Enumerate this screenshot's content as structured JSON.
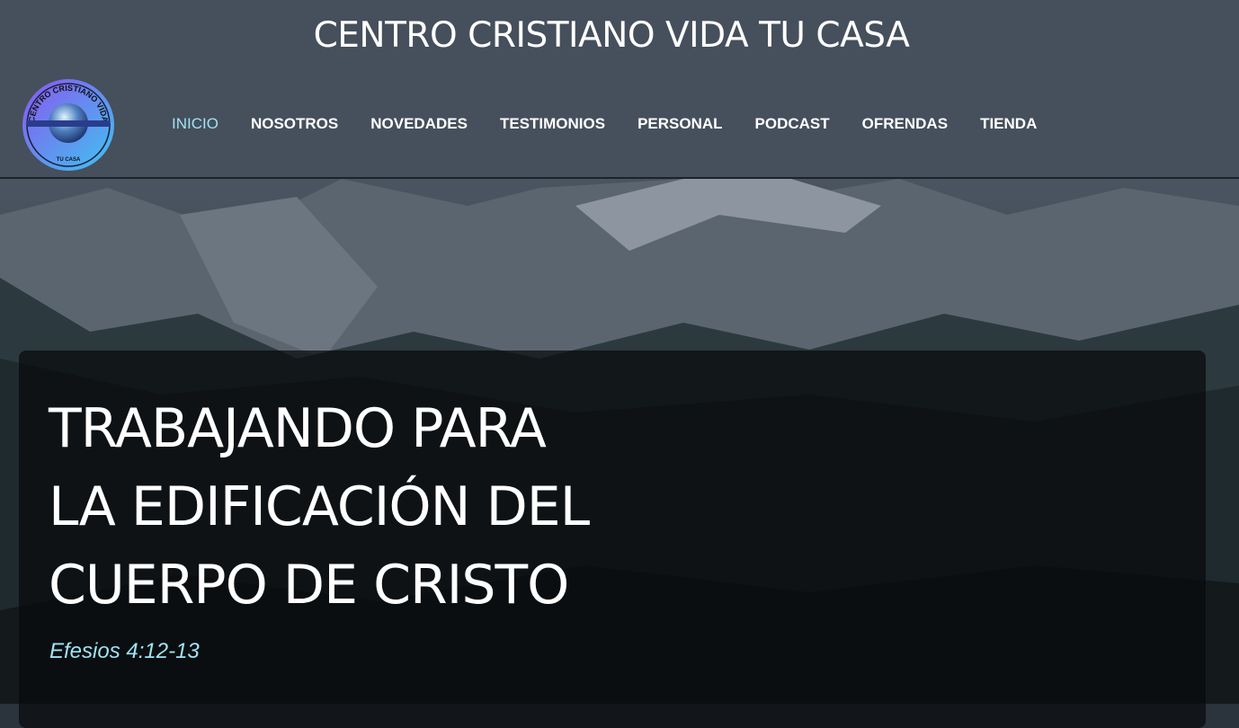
{
  "site": {
    "title": "CENTRO CRISTIANO VIDA TU CASA",
    "logo_text": "CENTRO CRISTIANO VIDA",
    "logo_subtext": "TU CASA"
  },
  "nav": {
    "items": [
      {
        "label": "INICIO",
        "active": true
      },
      {
        "label": "NOSOTROS",
        "active": false
      },
      {
        "label": "NOVEDADES",
        "active": false
      },
      {
        "label": "TESTIMONIOS",
        "active": false
      },
      {
        "label": "PERSONAL",
        "active": false
      },
      {
        "label": "PODCAST",
        "active": false
      },
      {
        "label": "OFRENDAS",
        "active": false
      },
      {
        "label": "TIENDA",
        "active": false
      }
    ]
  },
  "hero": {
    "title_lines": [
      "TRABAJANDO PARA",
      "LA EDIFICACIÓN DEL",
      "CUERPO DE CRISTO"
    ],
    "verse": "Efesios 4:12-13"
  },
  "colors": {
    "header_bg": "#464f5c",
    "accent": "#9fe3f5",
    "text": "#ffffff"
  }
}
